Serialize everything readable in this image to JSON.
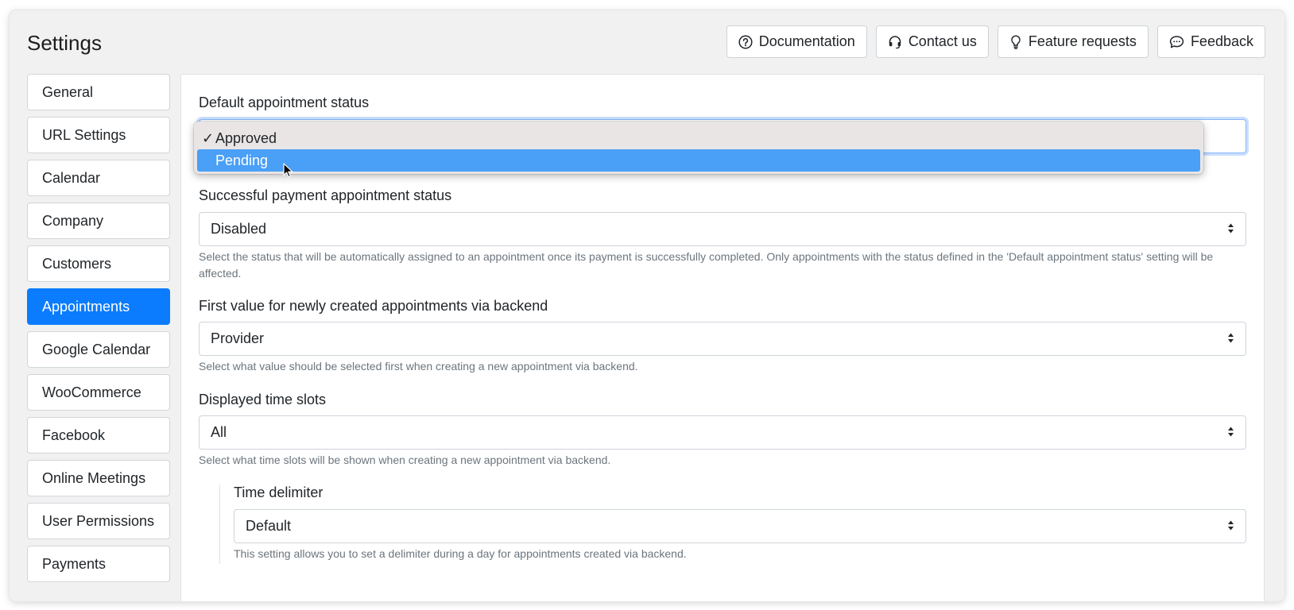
{
  "page": {
    "title": "Settings"
  },
  "header_buttons": [
    {
      "label": "Documentation",
      "icon": "question-circle-icon"
    },
    {
      "label": "Contact us",
      "icon": "headset-icon"
    },
    {
      "label": "Feature requests",
      "icon": "lightbulb-icon"
    },
    {
      "label": "Feedback",
      "icon": "chat-bubble-icon"
    }
  ],
  "sidebar": {
    "active": "Appointments",
    "items": [
      {
        "label": "General"
      },
      {
        "label": "URL Settings"
      },
      {
        "label": "Calendar"
      },
      {
        "label": "Company"
      },
      {
        "label": "Customers"
      },
      {
        "label": "Appointments"
      },
      {
        "label": "Google Calendar"
      },
      {
        "label": "WooCommerce"
      },
      {
        "label": "Facebook"
      },
      {
        "label": "Online Meetings"
      },
      {
        "label": "User Permissions"
      },
      {
        "label": "Payments"
      }
    ]
  },
  "fields": {
    "default_status": {
      "label": "Default appointment status",
      "options": [
        "Approved",
        "Pending"
      ],
      "selected": "Approved",
      "highlighted": "Pending",
      "check_glyph": "✓"
    },
    "payment_status": {
      "label": "Successful payment appointment status",
      "value": "Disabled",
      "help": "Select the status that will be automatically assigned to an appointment once its payment is successfully completed. Only appointments with the status defined in the 'Default appointment status' setting will be affected."
    },
    "first_value": {
      "label": "First value for newly created appointments via backend",
      "value": "Provider",
      "help": "Select what value should be selected first when creating a new appointment via backend."
    },
    "time_slots": {
      "label": "Displayed time slots",
      "value": "All",
      "help": "Select what time slots will be shown when creating a new appointment via backend."
    },
    "time_delimiter": {
      "label": "Time delimiter",
      "value": "Default",
      "help": "This setting allows you to set a delimiter during a day for appointments created via backend."
    }
  },
  "colors": {
    "accent": "#0b7cfe",
    "highlight": "#4a9ff6",
    "background": "#f1f1f1",
    "help_text": "#6c757d"
  }
}
